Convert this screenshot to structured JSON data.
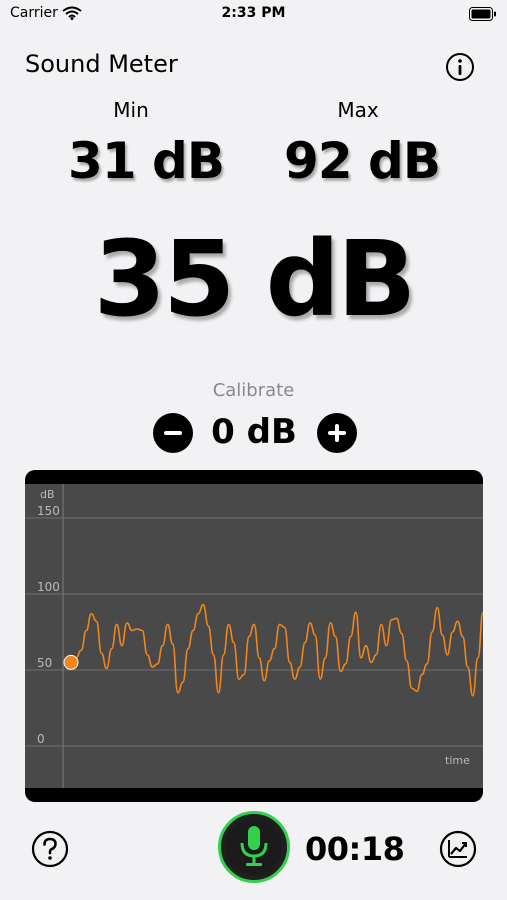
{
  "status_bar": {
    "carrier": "Carrier",
    "time": "2:33 PM"
  },
  "header": {
    "title": "Sound Meter",
    "info_icon": "info-circle-icon"
  },
  "stats": {
    "min_label": "Min",
    "min_value": "31 dB",
    "max_label": "Max",
    "max_value": "92 dB",
    "current": "35 dB"
  },
  "calibrate": {
    "label": "Calibrate",
    "value": "0 dB",
    "minus_icon": "minus-circle-icon",
    "plus_icon": "plus-circle-icon"
  },
  "chart_data": {
    "type": "line",
    "ylabel": "dB",
    "xlabel": "time",
    "yticks": [
      "150",
      "100",
      "50",
      "0"
    ],
    "ylim": [
      0,
      150
    ],
    "grid": true,
    "series": [
      {
        "color": "#f0861c",
        "values": [
          55,
          58,
          63,
          76,
          87,
          82,
          61,
          51,
          64,
          80,
          66,
          81,
          76,
          77,
          76,
          60,
          52,
          54,
          66,
          80,
          67,
          35,
          42,
          64,
          76,
          87,
          93,
          79,
          60,
          35,
          60,
          80,
          68,
          44,
          47,
          72,
          80,
          58,
          43,
          56,
          64,
          80,
          78,
          55,
          44,
          52,
          68,
          81,
          73,
          44,
          58,
          81,
          72,
          49,
          54,
          72,
          88,
          58,
          66,
          55,
          60,
          80,
          66,
          83,
          84,
          74,
          56,
          38,
          36,
          47,
          54,
          75,
          91,
          73,
          60,
          75,
          82,
          72,
          52,
          33,
          58,
          88
        ]
      }
    ],
    "marker_value": 55,
    "line_color": "#f0861c",
    "plot_bg": "#494949",
    "frame_bg": "#000000"
  },
  "footer": {
    "help_icon": "question-circle-icon",
    "mic_icon": "microphone-icon",
    "mic_ring_color": "#33d04b",
    "timer": "00:18",
    "stats_icon": "chart-trend-icon"
  }
}
